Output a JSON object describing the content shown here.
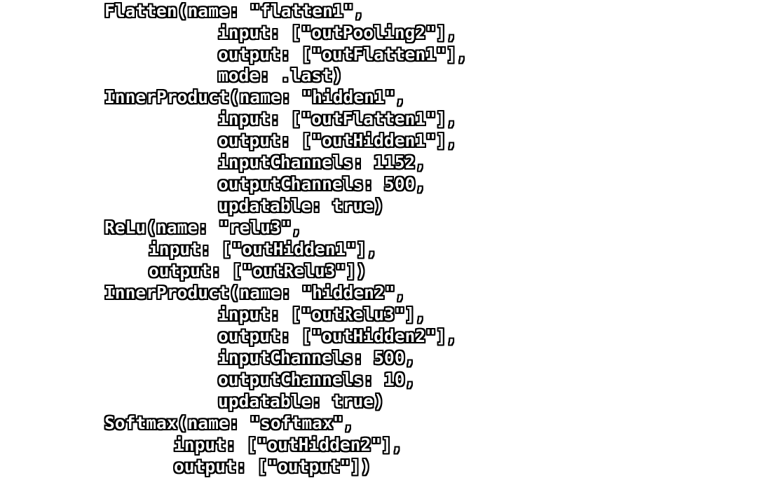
{
  "code": {
    "lines": [
      "Flatten(name: \"flatten1\",",
      "input: [\"outPooling2\"],",
      "output: [\"outFlatten1\"],",
      "mode: .last)",
      "InnerProduct(name: \"hidden1\",",
      "input: [\"outFlatten1\"],",
      "output: [\"outHidden1\"],",
      "inputChannels: 1152,",
      "outputChannels: 500,",
      "updatable: true)",
      "ReLu(name: \"relu3\",",
      "input: [\"outHidden1\"],",
      "output: [\"outRelu3\"])",
      "InnerProduct(name: \"hidden2\",",
      "input: [\"outRelu3\"],",
      "output: [\"outHidden2\"],",
      "inputChannels: 500,",
      "outputChannels: 10,",
      "updatable: true)",
      "Softmax(name: \"softmax\",",
      "input: [\"outHidden2\"],",
      "output: [\"output\"])"
    ]
  }
}
